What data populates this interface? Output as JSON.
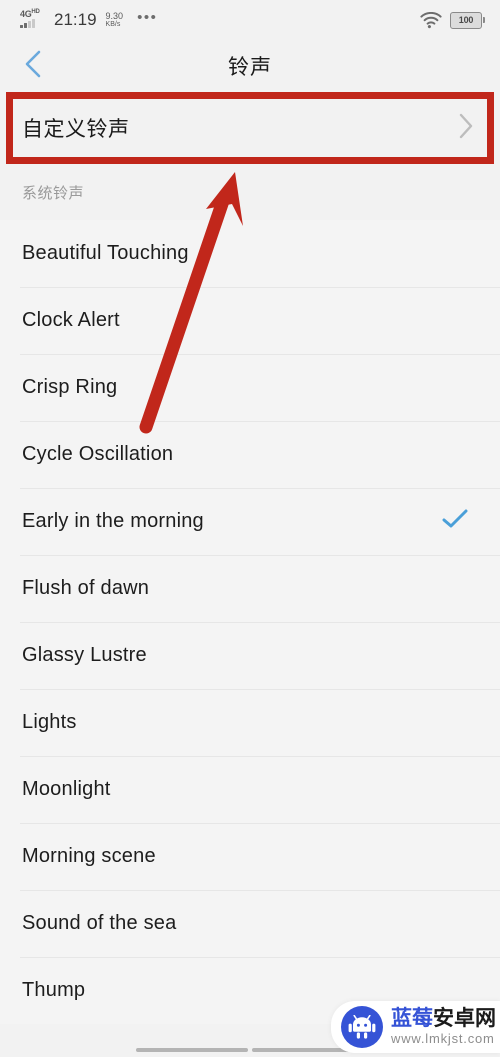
{
  "status_bar": {
    "network_type": "4G",
    "network_type_sup": "HD",
    "time": "21:19",
    "net_speed_value": "9.30",
    "net_speed_unit": "KB/s",
    "overflow_icon": "•••",
    "wifi_icon": "wifi-icon",
    "battery_level": "100"
  },
  "header": {
    "back_icon": "chevron-left-icon",
    "title": "铃声"
  },
  "custom_ringtone": {
    "label": "自定义铃声",
    "chevron_icon": "chevron-right-icon",
    "highlight_color": "#c1271b"
  },
  "section": {
    "title": "系统铃声"
  },
  "ringtones": [
    {
      "name": "Beautiful Touching",
      "selected": false
    },
    {
      "name": "Clock Alert",
      "selected": false
    },
    {
      "name": "Crisp Ring",
      "selected": false
    },
    {
      "name": "Cycle Oscillation",
      "selected": false
    },
    {
      "name": "Early in the morning",
      "selected": true
    },
    {
      "name": "Flush of dawn",
      "selected": false
    },
    {
      "name": "Glassy Lustre",
      "selected": false
    },
    {
      "name": "Lights",
      "selected": false
    },
    {
      "name": "Moonlight",
      "selected": false
    },
    {
      "name": "Morning scene",
      "selected": false
    },
    {
      "name": "Sound of the sea",
      "selected": false
    },
    {
      "name": "Thump",
      "selected": false
    }
  ],
  "theme": {
    "accent_check": "#4a9fd8",
    "back_chevron": "#6aa9dd",
    "annotation_red": "#c1271b",
    "text_primary": "#1d1d1d",
    "text_muted": "#9a9a9a"
  },
  "annotation": {
    "arrow_icon": "up-right-arrow-annotation"
  },
  "watermark": {
    "name_part1": "蓝莓",
    "name_part2": "安卓网",
    "url": "www.lmkjst.com",
    "logo_icon": "android-robot-icon"
  }
}
